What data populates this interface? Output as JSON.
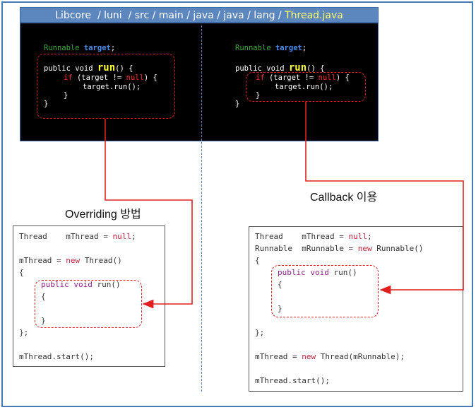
{
  "header": {
    "path": "Libcore  / luni  / src / main / java / java / lang / ",
    "file": "Thread.java"
  },
  "left_code": {
    "l1a": "Runnable",
    "l1b": "target",
    "l1c": ";",
    "l2a": "public void ",
    "l2b": "run",
    "l2c": "() {",
    "l3a": "if",
    "l3b": " (target != ",
    "l3c": "null",
    "l3d": ") {",
    "l4": "target.run();",
    "l5": "}",
    "l6": "}"
  },
  "right_code": {
    "l1a": "Runnable",
    "l1b": "target",
    "l1c": ";",
    "l2a": "public void ",
    "l2b": "run",
    "l2c": "() {",
    "l3a": "if",
    "l3b": " (target != ",
    "l3c": "null",
    "l3d": ") {",
    "l4": "target.run();",
    "l5": "}",
    "l6": "}"
  },
  "labels": {
    "overriding": "Overriding 방법",
    "callback": "Callback 이용"
  },
  "box_left": {
    "r1a": "Thread",
    "r1b": "mThread = ",
    "r1c": "null",
    "r1d": ";",
    "r2a": "mThread = ",
    "r2b": "new",
    "r2c": " Thread()",
    "r3": "{",
    "r4a": "public void",
    "r4b": " run()",
    "r5": "{",
    "r6": "}",
    "r7": "};",
    "r8": "mThread.start();"
  },
  "box_right": {
    "r1a": "Thread",
    "r1b": "mThread = ",
    "r1c": "null",
    "r1d": ";",
    "r2a": "Runnable",
    "r2b": "mRunnable = ",
    "r2c": "new",
    "r2d": " Runnable()",
    "r3": "{",
    "r4a": "public void",
    "r4b": " run()",
    "r5": "{",
    "r6": "}",
    "r7": "};",
    "r8a": "mThread = ",
    "r8b": "new",
    "r8c": " Thread(mRunnable);",
    "r9": "mThread.start();"
  },
  "colors": {
    "accent": "#5b86be",
    "code_bg": "#000000",
    "callout": "#e02020"
  }
}
